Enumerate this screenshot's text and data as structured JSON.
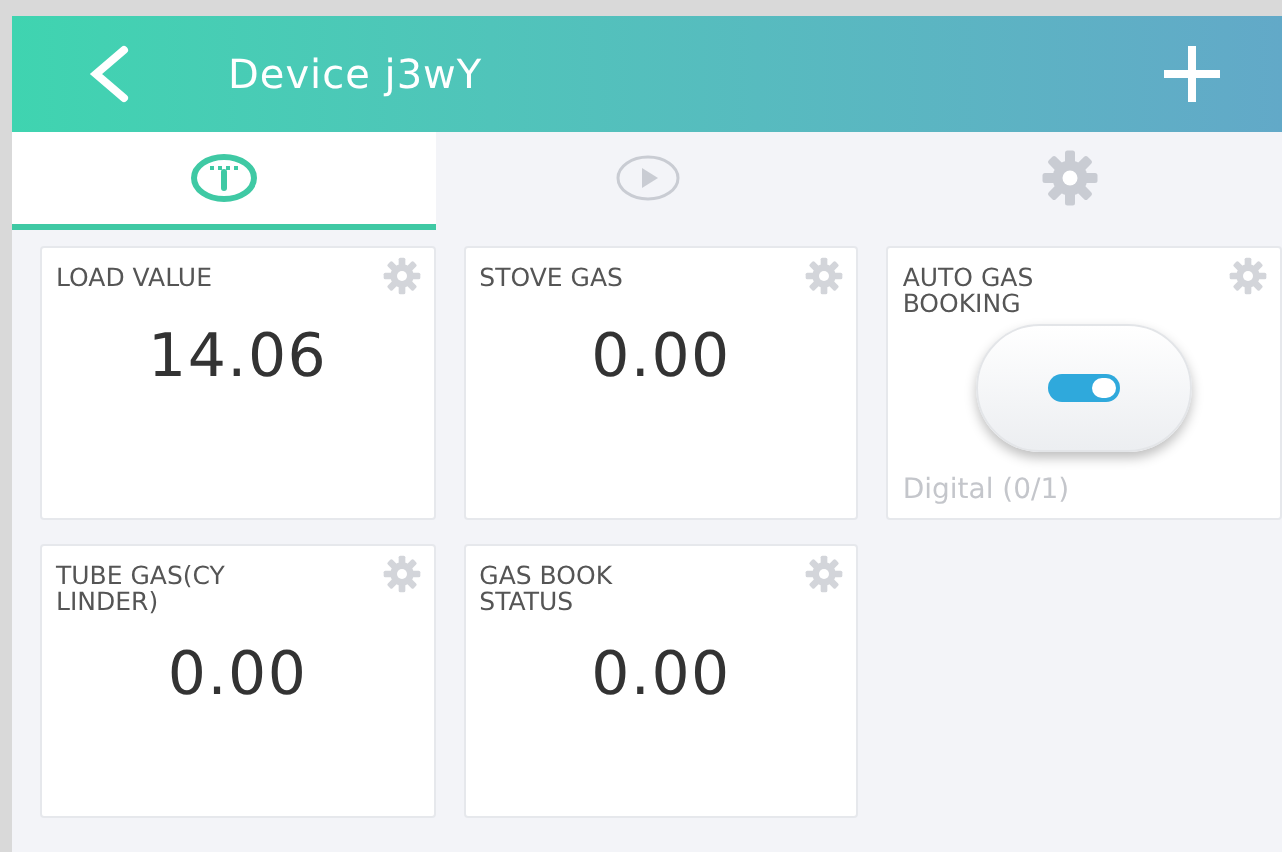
{
  "header": {
    "title": "Device j3wY"
  },
  "tabs": [
    {
      "kind": "gauge",
      "selected": true
    },
    {
      "kind": "play",
      "selected": false
    },
    {
      "kind": "settings",
      "selected": false
    }
  ],
  "widgets": [
    {
      "kind": "value",
      "title_lines": [
        "LOAD VALUE"
      ],
      "value": "14.06"
    },
    {
      "kind": "value",
      "title_lines": [
        "STOVE GAS"
      ],
      "value": "0.00"
    },
    {
      "kind": "button",
      "title_lines": [
        "AUTO GAS",
        "BOOKING"
      ],
      "on": true,
      "mode": "Digital (0/1)"
    },
    {
      "kind": "value",
      "title_lines": [
        "TUBE GAS(CY",
        "LINDER)"
      ],
      "value": "0.00"
    },
    {
      "kind": "value",
      "title_lines": [
        "GAS BOOK",
        "STATUS"
      ],
      "value": "0.00"
    }
  ]
}
